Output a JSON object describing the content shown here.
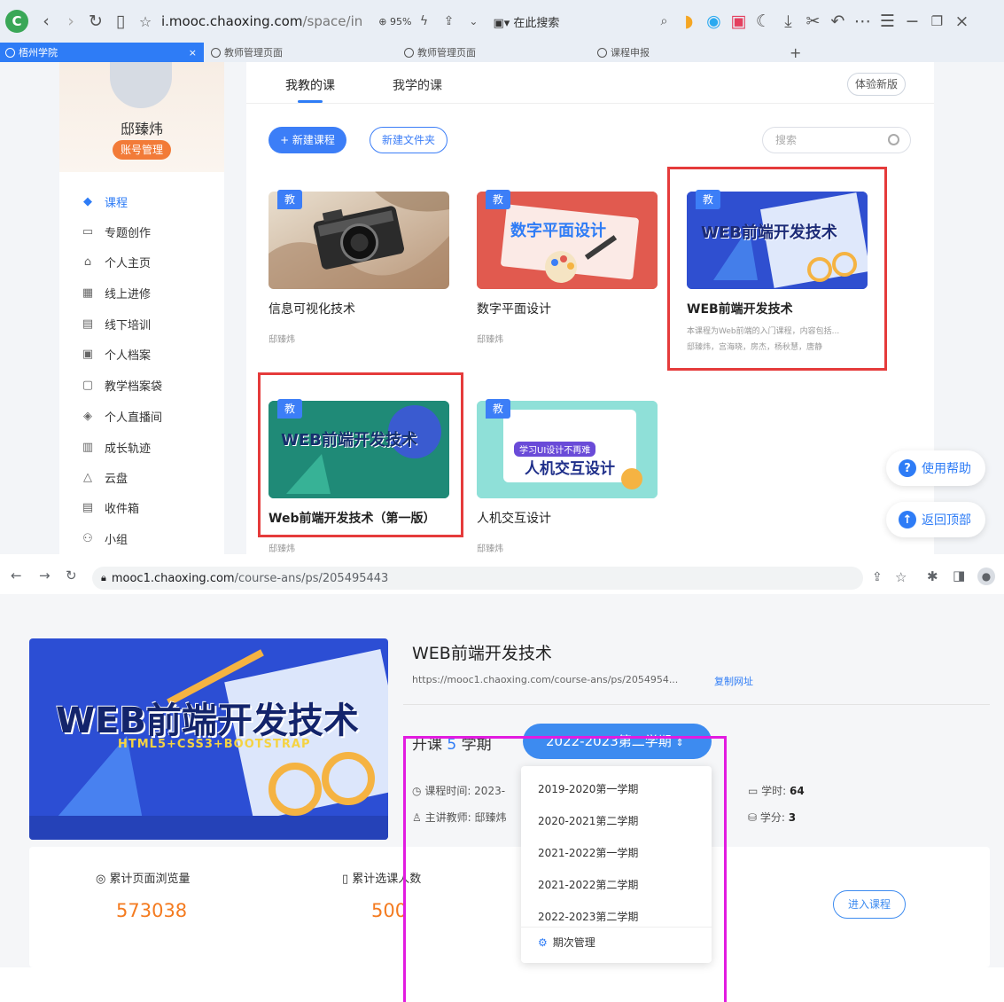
{
  "top_browser": {
    "toolbar": {
      "url_domain": "i.mooc.chaoxing.com",
      "url_path": "/space/in",
      "zoom": "95%",
      "search_placeholder": "在此搜索"
    },
    "tabs": [
      {
        "label": "梧州学院",
        "active": true
      },
      {
        "label": "教师管理页面",
        "active": false
      },
      {
        "label": "教师管理页面",
        "active": false
      },
      {
        "label": "课程申报",
        "active": false
      }
    ],
    "sidebar": {
      "username": "邸臻炜",
      "account_button": "账号管理",
      "items": [
        {
          "label": "课程",
          "icon": "graduation-cap-icon"
        },
        {
          "label": "专题创作",
          "icon": "window-icon"
        },
        {
          "label": "个人主页",
          "icon": "home-icon"
        },
        {
          "label": "线上进修",
          "icon": "online-training-icon"
        },
        {
          "label": "线下培训",
          "icon": "offline-training-icon"
        },
        {
          "label": "个人档案",
          "icon": "profile-icon"
        },
        {
          "label": "教学档案袋",
          "icon": "folder-icon"
        },
        {
          "label": "个人直播间",
          "icon": "live-icon"
        },
        {
          "label": "成长轨迹",
          "icon": "growth-icon"
        },
        {
          "label": "云盘",
          "icon": "cloud-icon"
        },
        {
          "label": "收件箱",
          "icon": "inbox-icon"
        },
        {
          "label": "小组",
          "icon": "group-icon"
        }
      ]
    },
    "main": {
      "tabs": [
        "我教的课",
        "我学的课"
      ],
      "new_version": "体验新版",
      "new_course_button": "+ 新建课程",
      "new_folder_button": "新建文件夹",
      "search_placeholder": "搜索",
      "badge": "教",
      "courses": [
        {
          "title": "信息可视化技术",
          "owner": "邸臻炜",
          "image_text": ""
        },
        {
          "title": "数字平面设计",
          "owner": "邸臻炜",
          "image_text": "数字平面设计"
        },
        {
          "title": "WEB前端开发技术",
          "desc": "本课程为Web前端的入门课程，内容包括...",
          "owner": "邸臻炜，宫海晓，房杰，杨秋慧，唐静",
          "image_text": "WEB前端开发技术"
        },
        {
          "title": "Web前端开发技术（第一版）",
          "owner": "邸臻炜",
          "image_text": "WEB前端开发技术"
        },
        {
          "title": "人机交互设计",
          "owner": "邸臻炜",
          "image_text": "人机交互设计",
          "image_sub": "学习UI设计不再难"
        }
      ],
      "help_button": "使用帮助",
      "top_button": "返回顶部"
    }
  },
  "bottom_browser": {
    "url_domain": "mooc1.chaoxing.com",
    "url_path": "/course-ans/ps/205495443",
    "course": {
      "banner_title": "WEB前端开发技术",
      "banner_sub": "HTML5+CSS3+BOOTSTRAP",
      "title": "WEB前端开发技术",
      "url": "https://mooc1.chaoxing.com/course-ans/ps/2054954...",
      "copy_link": "复制网址",
      "semester_prefix": "开课",
      "semester_count": "5",
      "semester_suffix": "学期",
      "selected_semester": "2022-2023第二学期",
      "time_label": "课程时间: ",
      "time_value": "2023-",
      "teacher_label": "主讲教师: ",
      "teacher_value": "邸臻炜",
      "hours_label": "学时: ",
      "hours_value": "64",
      "credits_label": "学分: ",
      "credits_value": "3",
      "semester_options": [
        "2019-2020第一学期",
        "2020-2021第二学期",
        "2021-2022第一学期",
        "2021-2022第二学期",
        "2022-2023第二学期"
      ],
      "semester_manage": "期次管理",
      "stats": {
        "views_label": "累计页面浏览量",
        "views_value": "573038",
        "students_label": "累计选课人数",
        "students_value": "500"
      },
      "enter_button": "进入课程"
    }
  },
  "colors": {
    "accent": "#2e7cf6",
    "highlight_red": "#e53b3b",
    "highlight_magenta": "#e21be0",
    "stat_orange": "#f47b20"
  }
}
